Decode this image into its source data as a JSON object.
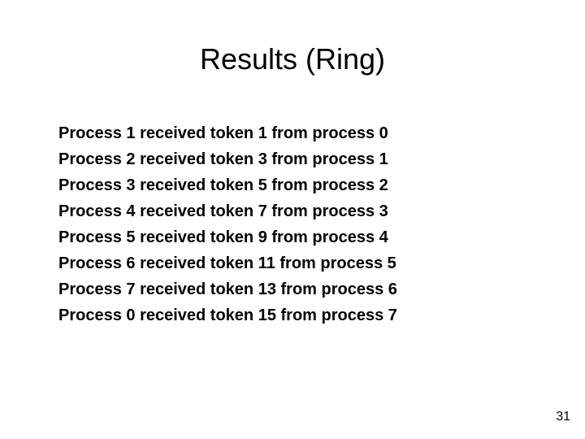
{
  "title": "Results (Ring)",
  "lines": [
    "Process 1 received token 1 from process 0",
    "Process 2 received token 3 from process 1",
    "Process 3 received token 5 from process 2",
    "Process 4 received token 7 from process 3",
    "Process 5 received token 9 from process 4",
    "Process 6 received token 11 from process 5",
    "Process 7 received token 13 from process 6",
    "Process 0 received token 15 from process 7"
  ],
  "page_number": "31"
}
